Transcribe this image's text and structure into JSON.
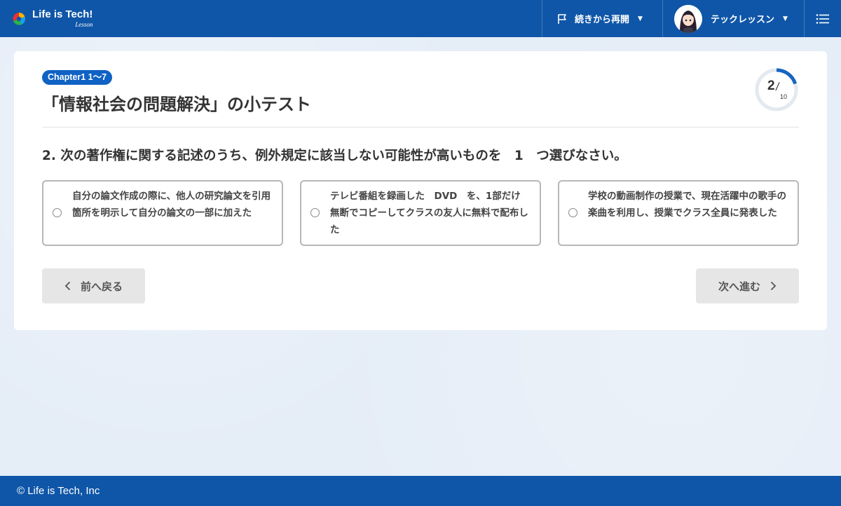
{
  "header": {
    "logo_title": "Life is Tech!",
    "logo_subtitle": "Lesson",
    "resume_label": "続きから再開",
    "user_name": "テックレッスン",
    "flag_icon": "flag-icon",
    "menu_icon": "list-menu-icon",
    "caret_icon": "caret-down-icon",
    "brand_color": "#0f56a8"
  },
  "quiz": {
    "chapter_badge": "Chapter1 1～7",
    "title": "「情報社会の問題解決」の小テスト",
    "progress": {
      "current": "2",
      "total": "10",
      "fraction": 0.2
    },
    "question": "2. 次の著作権に関する記述のうち、例外規定に該当しない可能性が高いものを　1　つ選びなさい。",
    "options": [
      {
        "text": "自分の論文作成の際に、他人の研究論文を引用箇所を明示して自分の論文の一部に加えた"
      },
      {
        "text": "テレビ番組を録画した　DVD　を、1部だけ無断でコピーしてクラスの友人に無料で配布した"
      },
      {
        "text": "学校の動画制作の授業で、現在活躍中の歌手の楽曲を利用し、授業でクラス全員に発表した"
      }
    ],
    "prev_label": "前へ戻る",
    "next_label": "次へ進む"
  },
  "footer": {
    "copyright": "© Life is Tech, Inc"
  },
  "colors": {
    "accent": "#1062c4",
    "progress_ring": "#1565c0",
    "progress_track": "#e4e9f0"
  }
}
